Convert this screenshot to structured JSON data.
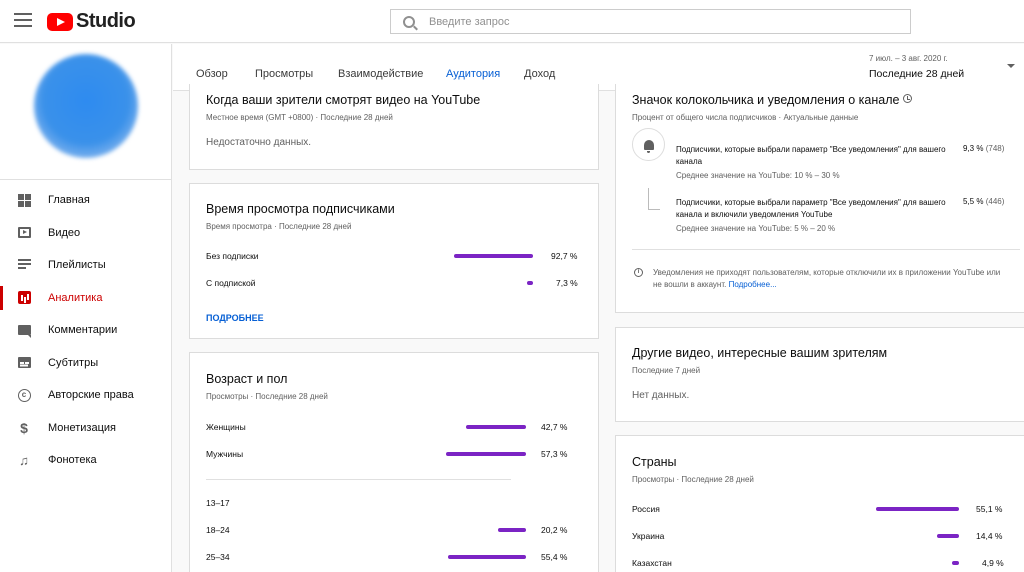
{
  "app": {
    "title": "Studio"
  },
  "search": {
    "placeholder": "Введите запрос"
  },
  "sidebar": {
    "items": [
      {
        "label": "Главная",
        "icon": "dashboard-icon"
      },
      {
        "label": "Видео",
        "icon": "video-icon"
      },
      {
        "label": "Плейлисты",
        "icon": "playlist-icon"
      },
      {
        "label": "Аналитика",
        "icon": "analytics-icon",
        "active": true
      },
      {
        "label": "Комментарии",
        "icon": "comments-icon"
      },
      {
        "label": "Субтитры",
        "icon": "subtitles-icon"
      },
      {
        "label": "Авторские права",
        "icon": "copyright-icon"
      },
      {
        "label": "Монетизация",
        "icon": "dollar-icon"
      },
      {
        "label": "Фонотека",
        "icon": "music-library-icon"
      }
    ]
  },
  "tabs": [
    {
      "label": "Обзор"
    },
    {
      "label": "Просмотры"
    },
    {
      "label": "Взаимодействие"
    },
    {
      "label": "Аудитория",
      "active": true
    },
    {
      "label": "Доход"
    }
  ],
  "date_range": {
    "dates": "7 июл. – 3 авг. 2020 г.",
    "label": "Последние 28 дней"
  },
  "when_watching": {
    "title": "Когда ваши зрители смотрят видео на YouTube",
    "subtitle": "Местное время (GMT +0800) · Последние 28 дней",
    "empty": "Недостаточно данных."
  },
  "subscriber_watch_time": {
    "title": "Время просмотра подписчиками",
    "subtitle": "Время просмотра · Последние 28 дней",
    "rows": [
      {
        "label": "Без подписки",
        "value": 92.7,
        "pct": "92,7 %"
      },
      {
        "label": "С подпиской",
        "value": 7.3,
        "pct": "7,3 %"
      }
    ],
    "more_link": "ПОДРОБНЕЕ"
  },
  "age_gender": {
    "title": "Возраст и пол",
    "subtitle": "Просмотры · Последние 28 дней",
    "gender": [
      {
        "label": "Женщины",
        "value": 42.7,
        "pct": "42,7 %"
      },
      {
        "label": "Мужчины",
        "value": 57.3,
        "pct": "57,3 %"
      }
    ],
    "age": [
      {
        "label": "13–17",
        "value": 0,
        "pct": ""
      },
      {
        "label": "18–24",
        "value": 20.2,
        "pct": "20,2 %"
      },
      {
        "label": "25–34",
        "value": 55.4,
        "pct": "55,4 %"
      }
    ]
  },
  "bell": {
    "title": "Значок колокольчика и уведомления о канале",
    "subtitle": "Процент от общего числа подписчиков · Актуальные данные",
    "items": [
      {
        "text": "Подписчики, которые выбрали параметр \"Все уведомления\" для вашего канала",
        "avg": "Среднее значение на YouTube: 10 % – 30 %",
        "pct": "9,3 %",
        "count": "(748)"
      },
      {
        "text": "Подписчики, которые выбрали параметр \"Все уведомления\" для вашего канала и включили уведомления YouTube",
        "avg": "Среднее значение на YouTube: 5 % – 20 %",
        "pct": "5,5 %",
        "count": "(446)"
      }
    ],
    "note": "Уведомления не приходят пользователям, которые отключили их в приложении YouTube или не вошли в аккаунт.",
    "note_link": "Подробнее..."
  },
  "other_videos": {
    "title": "Другие видео, интересные вашим зрителям",
    "subtitle": "Последние 7 дней",
    "empty": "Нет данных."
  },
  "countries": {
    "title": "Страны",
    "subtitle": "Просмотры · Последние 28 дней",
    "rows": [
      {
        "label": "Россия",
        "value": 55.1,
        "pct": "55,1 %"
      },
      {
        "label": "Украина",
        "value": 14.4,
        "pct": "14,4 %"
      },
      {
        "label": "Казахстан",
        "value": 4.9,
        "pct": "4,9 %"
      }
    ]
  },
  "colors": {
    "accent": "#065fd4",
    "bar": "#7b24c4",
    "active_nav": "#cc0000",
    "brand": "#ff0000"
  }
}
